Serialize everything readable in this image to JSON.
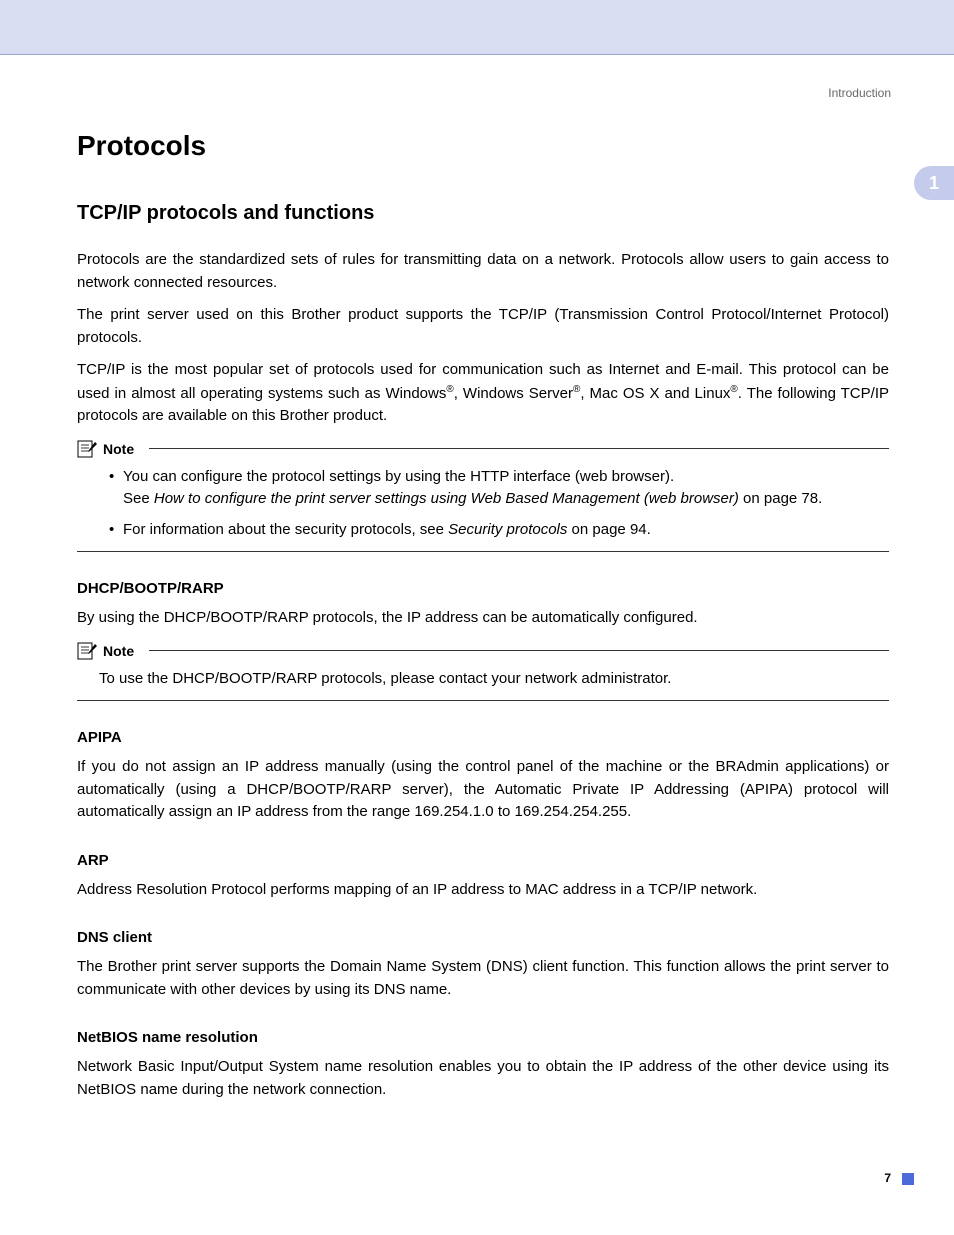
{
  "header": {
    "section": "Introduction",
    "chapter_number": "1",
    "page_number": "7"
  },
  "title": "Protocols",
  "subtitle": "TCP/IP protocols and functions",
  "intro": {
    "p1": "Protocols are the standardized sets of rules for transmitting data on a network. Protocols allow users to gain access to network connected resources.",
    "p2": "The print server used on this Brother product supports the TCP/IP (Transmission Control Protocol/Internet Protocol) protocols.",
    "p3a": "TCP/IP is the most popular set of protocols used for communication such as Internet and E-mail. This protocol can be used in almost all operating systems such as Windows",
    "p3b": ", Windows Server",
    "p3c": ", Mac OS X and Linux",
    "p3d": ". The following TCP/IP protocols are available on this Brother product.",
    "reg": "®"
  },
  "note1": {
    "label": "Note",
    "item1a": "You can configure the protocol settings by using the HTTP interface (web browser).",
    "item1b_pre": "See ",
    "item1b_italic": "How to configure the print server settings using Web Based Management (web browser)",
    "item1b_post": " on page 78.",
    "item2_pre": "For information about the security protocols, see ",
    "item2_italic": "Security protocols",
    "item2_post": " on page 94."
  },
  "dhcp": {
    "heading": "DHCP/BOOTP/RARP",
    "text": "By using the DHCP/BOOTP/RARP protocols, the IP address can be automatically configured."
  },
  "note2": {
    "label": "Note",
    "text": "To use the DHCP/BOOTP/RARP protocols, please contact your network administrator."
  },
  "apipa": {
    "heading": "APIPA",
    "text": "If you do not assign an IP address manually (using the control panel of the machine or the BRAdmin applications) or automatically (using a DHCP/BOOTP/RARP server), the Automatic Private IP Addressing (APIPA) protocol will automatically assign an IP address from the range 169.254.1.0 to 169.254.254.255."
  },
  "arp": {
    "heading": "ARP",
    "text": "Address Resolution Protocol performs mapping of an IP address to MAC address in a TCP/IP network."
  },
  "dns": {
    "heading": "DNS client",
    "text": "The Brother print server supports the Domain Name System (DNS) client function. This function allows the print server to communicate with other devices by using its DNS name."
  },
  "netbios": {
    "heading": "NetBIOS name resolution",
    "text": "Network Basic Input/Output System name resolution enables you to obtain the IP address of the other device using its NetBIOS name during the network connection."
  }
}
